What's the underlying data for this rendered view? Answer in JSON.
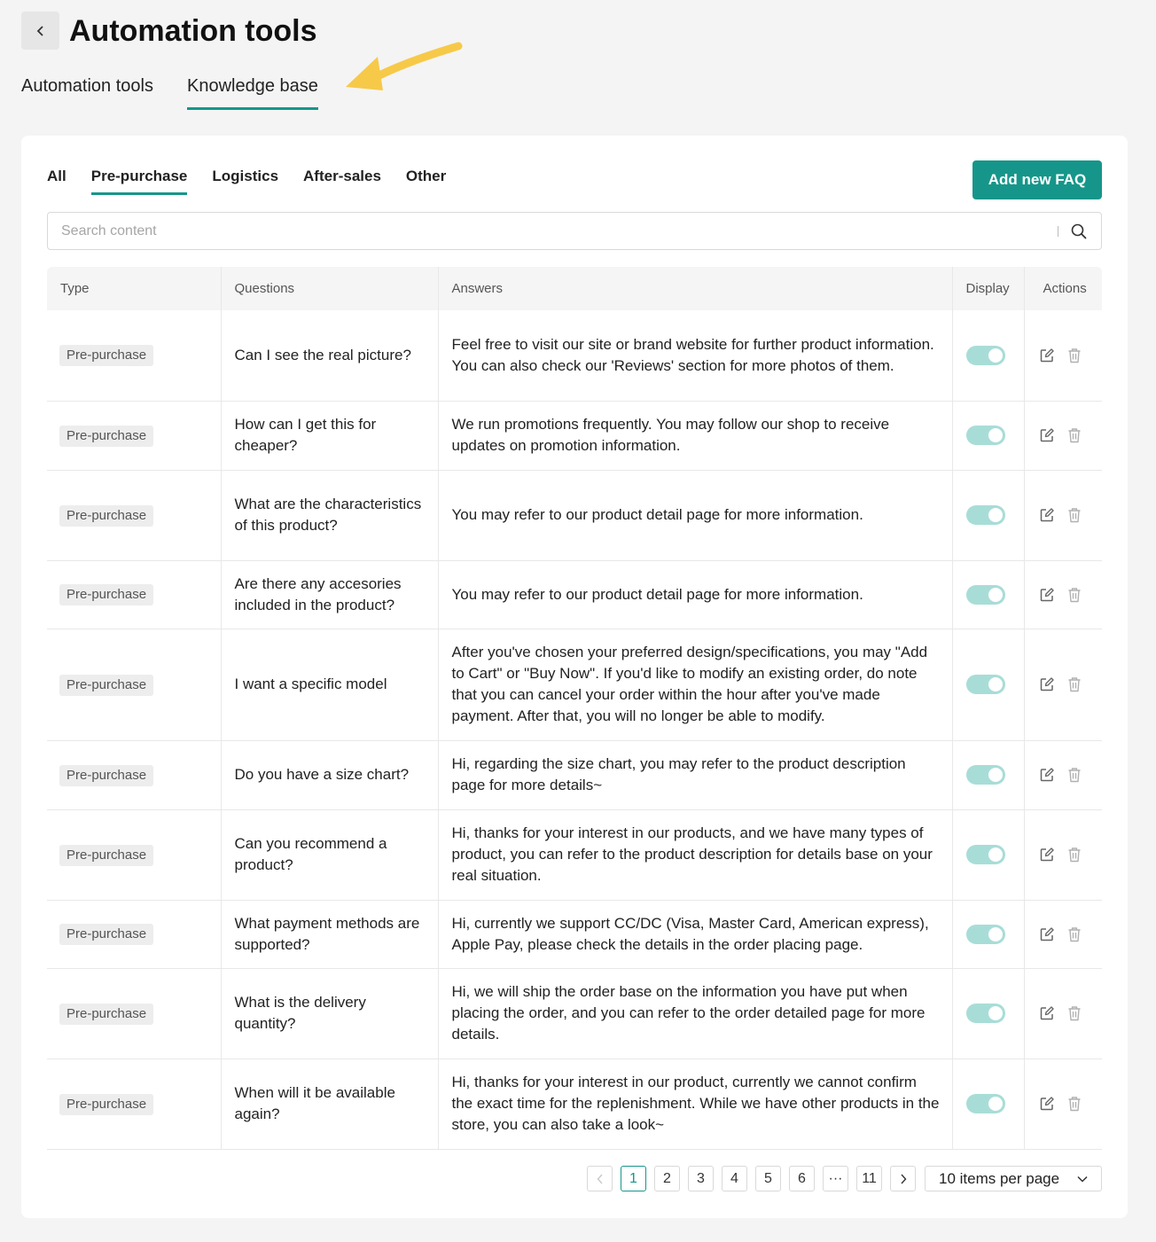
{
  "header": {
    "title": "Automation tools"
  },
  "main_tabs": [
    {
      "label": "Automation tools",
      "active": false
    },
    {
      "label": "Knowledge base",
      "active": true
    }
  ],
  "sub_tabs": [
    {
      "label": "All",
      "active": false
    },
    {
      "label": "Pre-purchase",
      "active": true
    },
    {
      "label": "Logistics",
      "active": false
    },
    {
      "label": "After-sales",
      "active": false
    },
    {
      "label": "Other",
      "active": false
    }
  ],
  "add_button": "Add new FAQ",
  "search": {
    "placeholder": "Search content",
    "value": ""
  },
  "columns": [
    "Type",
    "Questions",
    "Answers",
    "Display",
    "Actions"
  ],
  "rows": [
    {
      "type": "Pre-purchase",
      "question": "Can I see the real picture?",
      "answer": "Feel free to visit our site or brand website for further product information. You can also check our 'Reviews' section for more photos of them.",
      "display": true
    },
    {
      "type": "Pre-purchase",
      "question": "How can I get this for cheaper?",
      "answer": "We run promotions frequently. You may follow our shop to receive updates on promotion information.",
      "display": true
    },
    {
      "type": "Pre-purchase",
      "question": "What are the characteristics of this product?",
      "answer": "You may refer to our product detail page for more information.",
      "display": true
    },
    {
      "type": "Pre-purchase",
      "question": "Are there any accesories included in the product?",
      "answer": "You may refer to our product detail page for more information.",
      "display": true
    },
    {
      "type": "Pre-purchase",
      "question": "I want a specific model",
      "answer": "After you've chosen your preferred design/specifications, you may \"Add to Cart\" or \"Buy Now\". If you'd like to modify an existing order, do note that you can cancel your order within the hour after you've made payment. After that, you will no longer be able to modify.",
      "display": true
    },
    {
      "type": "Pre-purchase",
      "question": "Do you have a size chart?",
      "answer": "Hi, regarding the size chart, you may refer to the product description page for more details~",
      "display": true
    },
    {
      "type": "Pre-purchase",
      "question": "Can you recommend a product?",
      "answer": "Hi, thanks for your interest in our products, and we have many types of product, you can refer to the product description for details base on your real situation.",
      "display": true
    },
    {
      "type": "Pre-purchase",
      "question": "What payment methods are supported?",
      "answer": "Hi, currently we support CC/DC (Visa, Master Card, American express), Apple Pay, please check the details in the order placing page.",
      "display": true
    },
    {
      "type": "Pre-purchase",
      "question": "What is the delivery quantity?",
      "answer": "Hi, we will ship the order base on the information you have put when placing the order, and you can refer to the order detailed page for more details.",
      "display": true
    },
    {
      "type": "Pre-purchase",
      "question": "When will it be available again?",
      "answer": "Hi, thanks for your interest in our product, currently we cannot confirm the exact time for the replenishment. While we have other products in the store, you can also take a look~",
      "display": true
    }
  ],
  "pagination": {
    "pages": [
      "1",
      "2",
      "3",
      "4",
      "5",
      "6",
      "···",
      "11"
    ],
    "current": "1",
    "per_page": "10 items per page"
  },
  "colors": {
    "accent": "#16968a",
    "toggle_on": "#a8ddd7",
    "annotation_arrow": "#f7c948"
  }
}
